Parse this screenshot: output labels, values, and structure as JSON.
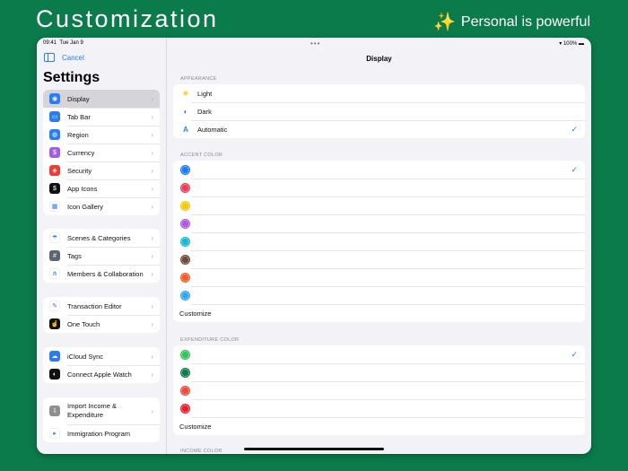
{
  "banner": {
    "title": "Customization",
    "tagline": "Personal is powerful",
    "tagline_icon": "sparkles"
  },
  "status": {
    "time": "09:41",
    "date": "Tue Jan 9",
    "battery": "100%"
  },
  "sidebar": {
    "cancel": "Cancel",
    "title": "Settings",
    "groups": [
      [
        {
          "label": "Display",
          "icon": "palette",
          "color": "#2a7bf6"
        },
        {
          "label": "Tab Bar",
          "icon": "tabbar",
          "color": "#2a7bf6"
        },
        {
          "label": "Region",
          "icon": "globe",
          "color": "#2a7bf6"
        },
        {
          "label": "Currency",
          "icon": "dollar",
          "color": "#a45de0"
        },
        {
          "label": "Security",
          "icon": "shield",
          "color": "#ef3b36"
        },
        {
          "label": "App Icons",
          "icon": "app",
          "color": "#111"
        },
        {
          "label": "Icon Gallery",
          "icon": "grid",
          "color": "#fff"
        }
      ],
      [
        {
          "label": "Scenes & Categories",
          "icon": "scenes",
          "color": "#fff"
        },
        {
          "label": "Tags",
          "icon": "hash",
          "color": "#5b6670"
        },
        {
          "label": "Members & Collaboration",
          "icon": "members",
          "color": "#fff"
        }
      ],
      [
        {
          "label": "Transaction Editor",
          "icon": "pencil",
          "color": "#fff"
        },
        {
          "label": "One Touch",
          "icon": "touch",
          "color": "#111"
        }
      ],
      [
        {
          "label": "iCloud Sync",
          "icon": "cloud",
          "color": "#2a7bf6"
        },
        {
          "label": "Connect Apple Watch",
          "icon": "watch",
          "color": "#111"
        }
      ],
      [
        {
          "label": "Import Income & Expenditure",
          "icon": "import",
          "color": "#8e8e93"
        },
        {
          "label": "Immigration Program",
          "icon": "terminal",
          "color": "#fff"
        }
      ]
    ]
  },
  "detail": {
    "title": "Display",
    "appearance": {
      "header": "APPEARANCE",
      "options": [
        {
          "label": "Light",
          "icon": "sun"
        },
        {
          "label": "Dark",
          "icon": "moon"
        },
        {
          "label": "Automatic",
          "icon": "A",
          "selected": true
        }
      ]
    },
    "accent": {
      "header": "ACCENT COLOR",
      "colors": [
        "#1a7cf5",
        "#f03a5a",
        "#f9c80e",
        "#b056e0",
        "#18b8d4",
        "#6b4a3a",
        "#f55a2a",
        "#2ea8f0"
      ],
      "selected": 0,
      "customize": "Customize"
    },
    "expenditure": {
      "header": "EXPENDITURE COLOR",
      "colors": [
        "#2fc55a",
        "#0e7a4a",
        "#f2483a",
        "#e8202e"
      ],
      "selected": 0,
      "customize": "Customize"
    },
    "income": {
      "header": "INCOME COLOR"
    }
  }
}
